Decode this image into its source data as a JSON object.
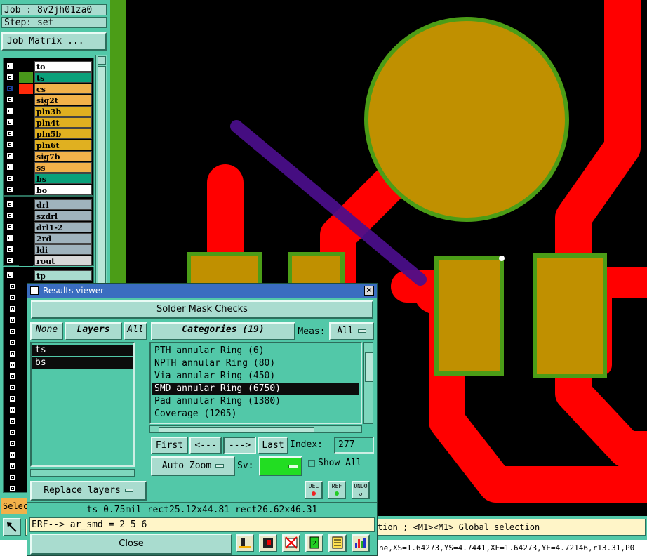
{
  "job_label": "Job : 8v2jh01za0",
  "step_label": "Step: set",
  "job_matrix_button": "Job Matrix ...",
  "layers_group1": [
    {
      "name": "to",
      "color": "#ffffff",
      "sw": "#000000"
    },
    {
      "name": "ts",
      "color": "#0aa07a",
      "sw": "#48961a"
    },
    {
      "name": "cs",
      "color": "#f2b14a",
      "sw": "#ff2a0a",
      "active": true
    },
    {
      "name": "sig2t",
      "color": "#f2b14a",
      "sw": "#000000"
    },
    {
      "name": "pln3b",
      "color": "#e0b020",
      "sw": "#000000"
    },
    {
      "name": "pln4t",
      "color": "#e0b020",
      "sw": "#000000"
    },
    {
      "name": "pln5b",
      "color": "#e0b020",
      "sw": "#000000"
    },
    {
      "name": "pln6t",
      "color": "#e0b020",
      "sw": "#000000"
    },
    {
      "name": "sig7b",
      "color": "#f2b14a",
      "sw": "#000000"
    },
    {
      "name": "ss",
      "color": "#f2b14a",
      "sw": "#000000"
    },
    {
      "name": "bs",
      "color": "#0aa07a",
      "sw": "#000000"
    },
    {
      "name": "bo",
      "color": "#ffffff",
      "sw": "#000000"
    }
  ],
  "layers_group2": [
    {
      "name": "drl",
      "color": "#9fb3bd"
    },
    {
      "name": "szdrl",
      "color": "#9fb3bd"
    },
    {
      "name": "drl1-2",
      "color": "#9fb3bd"
    },
    {
      "name": "2rd",
      "color": "#9fb3bd"
    },
    {
      "name": "ldi",
      "color": "#9fb3bd"
    },
    {
      "name": "rout",
      "color": "#d8d8d8"
    }
  ],
  "layers_group3": [
    {
      "name": "tp",
      "color": "#a9dccf"
    }
  ],
  "select_label_partial": "Selec",
  "status": {
    "line1_suffix": "tion ; <M1><M1> Global selection",
    "line2_suffix": "ne,XS=1.64273,YS=4.7441,XE=1.64273,YE=4.72146,r13.31,P0"
  },
  "results_viewer": {
    "title": "Results viewer",
    "heading": "Solder Mask Checks",
    "none_button": "None",
    "layers_button": "Layers",
    "all_button": "All",
    "categories_button": "Categories (19)",
    "meas_label": "Meas:",
    "meas_value": "All",
    "layers_list": [
      "ts",
      "bs"
    ],
    "categories": [
      "PTH annular Ring (6)",
      "NPTH annular Ring (80)",
      "Via annular Ring (450)",
      "SMD annular Ring (6750)",
      "Pad annular Ring (1380)",
      "Coverage (1205)"
    ],
    "selected_category_index": 3,
    "first_button": "First",
    "prev_button": "<---",
    "next_button": "--->",
    "last_button": "Last",
    "index_label": "Index:",
    "index_value": "277",
    "auto_zoom": "Auto Zoom",
    "sv_label": "Sv:",
    "show_all_label": "Show All",
    "replace_layers": "Replace layers",
    "del_label": "DEL",
    "ref_label": "REF",
    "undo_label": "UNDO",
    "measure_line": "ts 0.75mil  rect25.12x44.81  rect26.62x46.31",
    "erf_line": "ERF--> ar_smd = 2 5 6",
    "close_button": "Close"
  },
  "colors": {
    "panel": "#52c8a8",
    "copper": "#ff0000",
    "pad": "#c09000",
    "mask_ring": "#4b9d17",
    "measure": "#4b0f8c"
  }
}
